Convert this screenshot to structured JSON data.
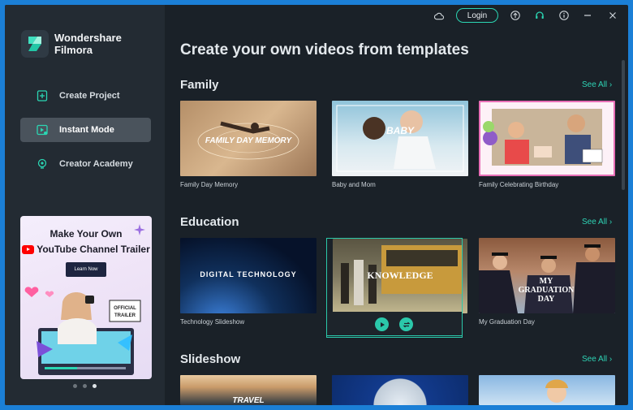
{
  "brand": {
    "name_line1": "Wondershare",
    "name_line2": "Filmora"
  },
  "sidebar": {
    "items": [
      {
        "label": "Create Project",
        "icon": "plus-file-icon",
        "active": false
      },
      {
        "label": "Instant Mode",
        "icon": "instant-mode-icon",
        "active": true
      },
      {
        "label": "Creator Academy",
        "icon": "academy-bulb-icon",
        "active": false
      }
    ]
  },
  "promo": {
    "title": "Make Your Own",
    "subtitle": "YouTube Channel Trailer",
    "button": "Learn Now",
    "badge": "OFFICIAL TRAILER",
    "dots": [
      false,
      false,
      true
    ]
  },
  "titlebar": {
    "login": "Login"
  },
  "main": {
    "title": "Create your own videos from templates",
    "sections": [
      {
        "name": "Family",
        "see_all": "See All",
        "templates": [
          {
            "caption": "Family Day Memory",
            "overlay": "FAMILY DAY MEMORY"
          },
          {
            "caption": "Baby and Mom",
            "overlay": "BABY"
          },
          {
            "caption": "Family Celebrating Birthday",
            "overlay": ""
          }
        ]
      },
      {
        "name": "Education",
        "see_all": "See All",
        "templates": [
          {
            "caption": "Technology Slideshow",
            "overlay": "DIGITAL TECHNOLOGY"
          },
          {
            "caption": "",
            "overlay": "KNOWLEDGE"
          },
          {
            "caption": "My Graduation Day",
            "overlay": "MY GRADUATION DAY"
          }
        ]
      },
      {
        "name": "Slideshow",
        "see_all": "See All",
        "templates": [
          {
            "caption": "",
            "overlay": "TRAVEL"
          },
          {
            "caption": "",
            "overlay": ""
          },
          {
            "caption": "",
            "overlay": ""
          }
        ]
      }
    ]
  },
  "colors": {
    "accent": "#2bd6b3",
    "sidebar_bg": "#232b33",
    "main_bg": "#1a2128"
  }
}
